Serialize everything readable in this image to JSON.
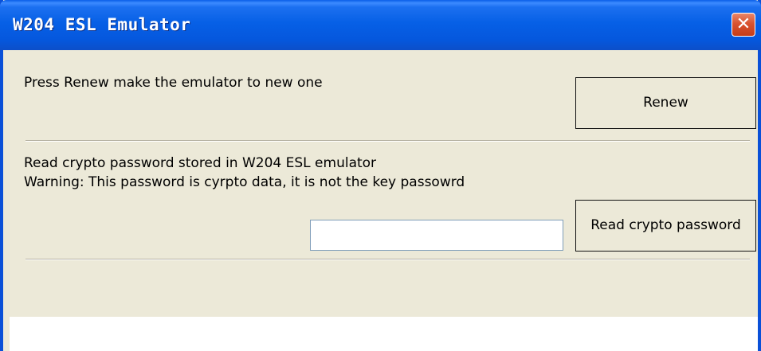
{
  "window": {
    "title": "W204 ESL Emulator",
    "close_glyph": "✕"
  },
  "renew_section": {
    "instruction": "Press Renew make the emulator to new one",
    "renew_button_label": "Renew"
  },
  "crypto_section": {
    "description_line1": "Read crypto password stored in W204 ESL emulator",
    "description_line2": "Warning: This password is cyrpto data, it is not the key passowrd",
    "password_value": "",
    "read_button_label": "Read crypto password"
  },
  "colors": {
    "titlebar_blue": "#0760e6",
    "window_face": "#ece9d8",
    "close_red": "#d9532f"
  }
}
